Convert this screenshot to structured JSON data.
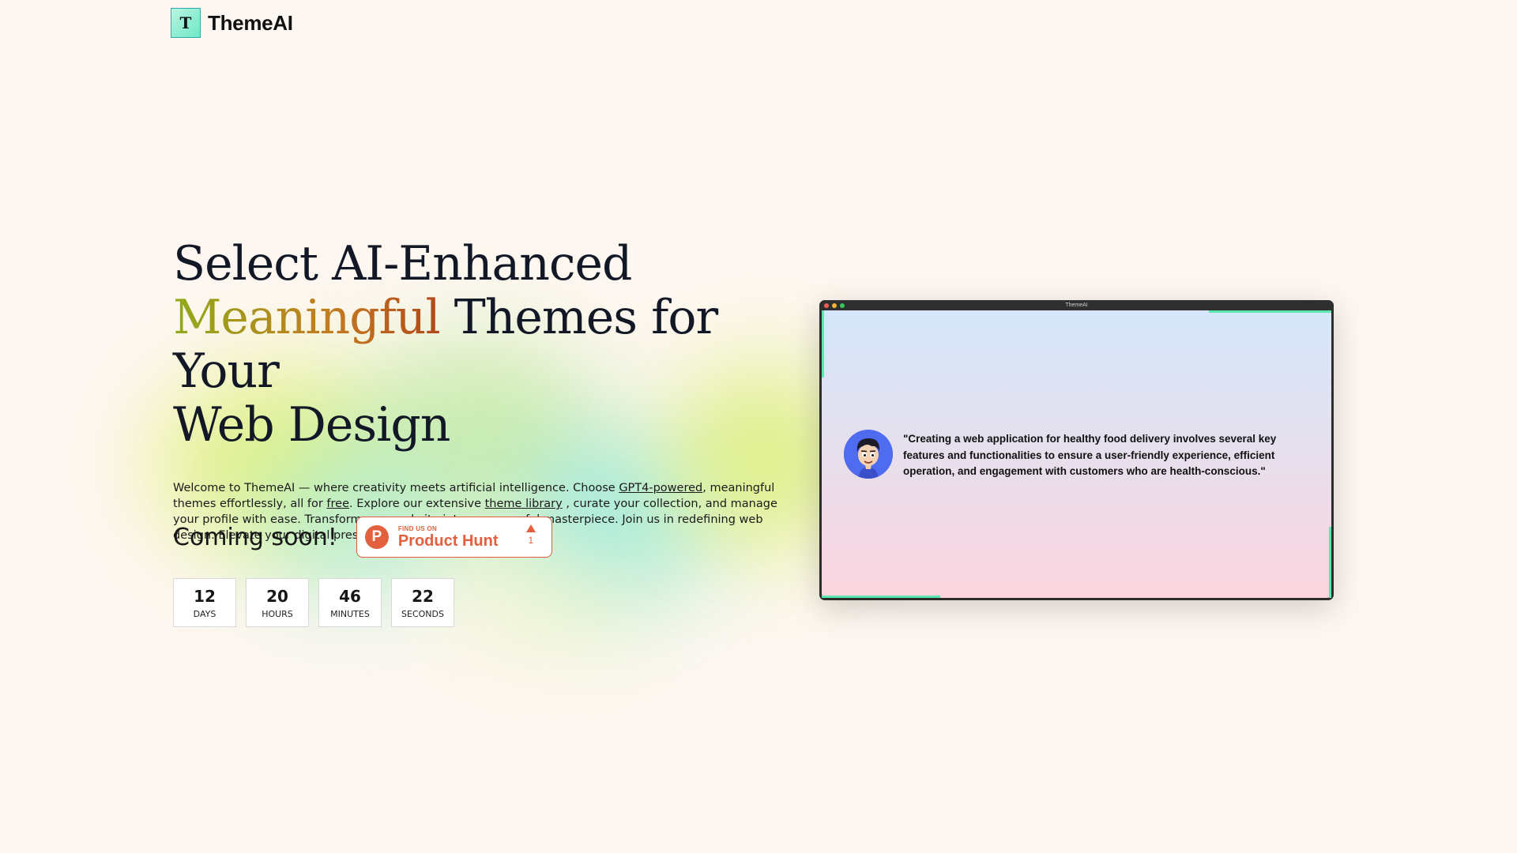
{
  "header": {
    "logo_letter": "T",
    "brand": "ThemeAI"
  },
  "hero": {
    "headline_line1": "Select AI-Enhanced",
    "headline_accent": "Meaningful",
    "headline_line2_rest": " Themes for Your",
    "headline_line3": "Web Design",
    "desc_part1": "Welcome to ThemeAI — where creativity meets artificial intelligence. Choose ",
    "desc_link_gpt": "GPT4-powered",
    "desc_part2": ", meaningful themes effortlessly, all for ",
    "desc_link_free": "free",
    "desc_part3": ". Explore our extensive ",
    "desc_link_library": "theme library",
    "desc_part4": " , curate your collection, and manage your profile with ease. Transform your website into a purposeful masterpiece. Join us in redefining web design. Elevate your digital presence today!"
  },
  "cta": {
    "coming_soon": "Coming soon!",
    "product_hunt": {
      "logo_letter": "P",
      "small_text": "FIND US ON",
      "big_text": "Product Hunt",
      "votes": "1"
    }
  },
  "countdown": [
    {
      "value": "12",
      "label": "DAYS"
    },
    {
      "value": "20",
      "label": "HOURS"
    },
    {
      "value": "46",
      "label": "MINUTES"
    },
    {
      "value": "22",
      "label": "SECONDS"
    }
  ],
  "preview": {
    "window_title": "ThemeAI",
    "quote": "\"Creating a web application for healthy food delivery involves several key features and functionalities to ensure a user-friendly experience, efficient operation, and engagement with customers who are health-conscious.\""
  },
  "colors": {
    "background": "#fef7f1",
    "accent_start": "#8faa1a",
    "accent_end": "#b0481a",
    "product_hunt": "#e3603f",
    "edge_glow": "#5ee6b0"
  }
}
